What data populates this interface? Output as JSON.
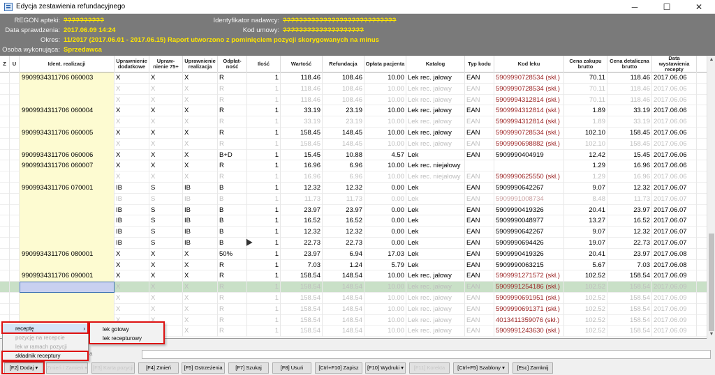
{
  "window": {
    "title": "Edycja zestawienia refundacyjnego",
    "min": "─",
    "max": "☐",
    "close": "✕"
  },
  "header": {
    "regon_label": "REGON apteki:",
    "regon_value": "??????????",
    "data_label": "Data sprawdzenia:",
    "data_value": "2017.06.09 14:24",
    "okres_label": "Okres:",
    "okres_value": "11/2017 (2017.06.01 - 2017.06.15) Raport utworzono z pominięciem pozycji skorygowanych na minus",
    "osoba_label": "Osoba wykonująca:",
    "osoba_value": "Sprzedawca",
    "nadawca_label": "Identyfikator nadawcy:",
    "nadawca_value": "????????????????????????????",
    "umowa_label": "Kod umowy:",
    "umowa_value": "????????????????????"
  },
  "columns": [
    "Z",
    "U",
    "Ident. realizacji",
    "Uprawnienie dodatkowe",
    "Upraw-nienie 75+",
    "Uprawnienie realizacja",
    "Odpłat-ność",
    "Ilość",
    "Wartość",
    "Refundacja",
    "Opłata pacjenta",
    "Katalog",
    "Typ kodu",
    "Kod leku",
    "Cena zakupu brutto",
    "Cena detaliczna brutto",
    "Data wystawienia recepty"
  ],
  "rows": [
    {
      "d": 0,
      "id": "9909934311706  060003",
      "ud": "X",
      "u75": "X",
      "ur": "X",
      "od": "R",
      "il": "1",
      "wa": "118.46",
      "re": "108.46",
      "op": "10.00",
      "ka": "Lek rec. jałowy",
      "ty": "EAN",
      "kod": "5909990728534 (skł.)",
      "red": 1,
      "cz": "70.11",
      "cd": "118.46",
      "dt": "2017.06.06"
    },
    {
      "d": 1,
      "id": "",
      "ud": "X",
      "u75": "X",
      "ur": "X",
      "od": "R",
      "il": "1",
      "wa": "118.46",
      "re": "108.46",
      "op": "10.00",
      "ka": "Lek rec. jałowy",
      "ty": "EAN",
      "kod": "5909990728534 (skł.)",
      "red": 1,
      "cz": "70.11",
      "cd": "118.46",
      "dt": "2017.06.06"
    },
    {
      "d": 1,
      "id": "",
      "ud": "X",
      "u75": "X",
      "ur": "X",
      "od": "R",
      "il": "1",
      "wa": "118.46",
      "re": "108.46",
      "op": "10.00",
      "ka": "Lek rec. jałowy",
      "ty": "EAN",
      "kod": "5909994312814 (skł.)",
      "red": 1,
      "cz": "70.11",
      "cd": "118.46",
      "dt": "2017.06.06"
    },
    {
      "d": 0,
      "id": "9909934311706  060004",
      "ud": "X",
      "u75": "X",
      "ur": "X",
      "od": "R",
      "il": "1",
      "wa": "33.19",
      "re": "23.19",
      "op": "10.00",
      "ka": "Lek rec. jałowy",
      "ty": "EAN",
      "kod": "5909994312814 (skł.)",
      "red": 1,
      "cz": "1.89",
      "cd": "33.19",
      "dt": "2017.06.06"
    },
    {
      "d": 1,
      "id": "",
      "ud": "X",
      "u75": "X",
      "ur": "X",
      "od": "R",
      "il": "1",
      "wa": "33.19",
      "re": "23.19",
      "op": "10.00",
      "ka": "Lek rec. jałowy",
      "ty": "EAN",
      "kod": "5909994312814 (skł.)",
      "red": 1,
      "cz": "1.89",
      "cd": "33.19",
      "dt": "2017.06.06"
    },
    {
      "d": 0,
      "id": "9909934311706  060005",
      "ud": "X",
      "u75": "X",
      "ur": "X",
      "od": "R",
      "il": "1",
      "wa": "158.45",
      "re": "148.45",
      "op": "10.00",
      "ka": "Lek rec. jałowy",
      "ty": "EAN",
      "kod": "5909990728534 (skł.)",
      "red": 1,
      "cz": "102.10",
      "cd": "158.45",
      "dt": "2017.06.06"
    },
    {
      "d": 1,
      "id": "",
      "ud": "X",
      "u75": "X",
      "ur": "X",
      "od": "R",
      "il": "1",
      "wa": "158.45",
      "re": "148.45",
      "op": "10.00",
      "ka": "Lek rec. jałowy",
      "ty": "EAN",
      "kod": "5909990698882 (skł.)",
      "red": 1,
      "cz": "102.10",
      "cd": "158.45",
      "dt": "2017.06.06"
    },
    {
      "d": 0,
      "id": "9909934311706  060006",
      "ud": "X",
      "u75": "X",
      "ur": "X",
      "od": "B+D",
      "il": "1",
      "wa": "15.45",
      "re": "10.88",
      "op": "4.57",
      "ka": "Lek",
      "ty": "EAN",
      "kod": "5909990404919",
      "red": 0,
      "cz": "12.42",
      "cd": "15.45",
      "dt": "2017.06.06"
    },
    {
      "d": 0,
      "id": "9909934311706  060007",
      "ud": "X",
      "u75": "X",
      "ur": "X",
      "od": "R",
      "il": "1",
      "wa": "16.96",
      "re": "6.96",
      "op": "10.00",
      "ka": "Lek rec. niejałowy",
      "ty": "",
      "kod": "",
      "red": 0,
      "cz": "1.29",
      "cd": "16.96",
      "dt": "2017.06.06"
    },
    {
      "d": 1,
      "id": "",
      "ud": "X",
      "u75": "X",
      "ur": "X",
      "od": "R",
      "il": "1",
      "wa": "16.96",
      "re": "6.96",
      "op": "10.00",
      "ka": "Lek rec. niejałowy",
      "ty": "EAN",
      "kod": "5909990625550 (skł.)",
      "red": 1,
      "cz": "1.29",
      "cd": "16.96",
      "dt": "2017.06.06"
    },
    {
      "d": 0,
      "id": "9909934311706  070001",
      "ud": "IB",
      "u75": "S",
      "ur": "IB",
      "od": "B",
      "il": "1",
      "wa": "12.32",
      "re": "12.32",
      "op": "0.00",
      "ka": "Lek",
      "ty": "EAN",
      "kod": "5909990642267",
      "red": 0,
      "cz": "9.07",
      "cd": "12.32",
      "dt": "2017.06.07"
    },
    {
      "d": 1,
      "id": "",
      "ud": "IB",
      "u75": "S",
      "ur": "IB",
      "od": "B",
      "il": "1",
      "wa": "11.73",
      "re": "11.73",
      "op": "0.00",
      "ka": "Lek",
      "ty": "EAN",
      "kod": "5909991008734",
      "red": 0,
      "cz": "8.48",
      "cd": "11.73",
      "dt": "2017.06.07"
    },
    {
      "d": 0,
      "id": "",
      "ud": "IB",
      "u75": "S",
      "ur": "IB",
      "od": "B",
      "il": "1",
      "wa": "23.97",
      "re": "23.97",
      "op": "0.00",
      "ka": "Lek",
      "ty": "EAN",
      "kod": "5909990419326",
      "red": 0,
      "cz": "20.41",
      "cd": "23.97",
      "dt": "2017.06.07"
    },
    {
      "d": 0,
      "id": "",
      "ud": "IB",
      "u75": "S",
      "ur": "IB",
      "od": "B",
      "il": "1",
      "wa": "16.52",
      "re": "16.52",
      "op": "0.00",
      "ka": "Lek",
      "ty": "EAN",
      "kod": "5909990048977",
      "red": 0,
      "cz": "13.27",
      "cd": "16.52",
      "dt": "2017.06.07"
    },
    {
      "d": 0,
      "id": "",
      "ud": "IB",
      "u75": "S",
      "ur": "IB",
      "od": "B",
      "il": "1",
      "wa": "12.32",
      "re": "12.32",
      "op": "0.00",
      "ka": "Lek",
      "ty": "EAN",
      "kod": "5909990642267",
      "red": 0,
      "cz": "9.07",
      "cd": "12.32",
      "dt": "2017.06.07"
    },
    {
      "d": 0,
      "id": "",
      "ud": "IB",
      "u75": "S",
      "ur": "IB",
      "od": "B",
      "il": "1",
      "wa": "22.73",
      "re": "22.73",
      "op": "0.00",
      "ka": "Lek",
      "ty": "EAN",
      "kod": "5909990694426",
      "red": 0,
      "cz": "19.07",
      "cd": "22.73",
      "dt": "2017.06.07"
    },
    {
      "d": 0,
      "id": "9909934311706  080001",
      "ud": "X",
      "u75": "X",
      "ur": "X",
      "od": "50%",
      "il": "1",
      "wa": "23.97",
      "re": "6.94",
      "op": "17.03",
      "ka": "Lek",
      "ty": "EAN",
      "kod": "5909990419326",
      "red": 0,
      "cz": "20.41",
      "cd": "23.97",
      "dt": "2017.06.08"
    },
    {
      "d": 0,
      "id": "",
      "ud": "X",
      "u75": "X",
      "ur": "X",
      "od": "R",
      "il": "1",
      "wa": "7.03",
      "re": "1.24",
      "op": "5.79",
      "ka": "Lek",
      "ty": "EAN",
      "kod": "5909990063215",
      "red": 0,
      "cz": "5.67",
      "cd": "7.03",
      "dt": "2017.06.08"
    },
    {
      "d": 0,
      "id": "9909934311706  090001",
      "ud": "X",
      "u75": "X",
      "ur": "X",
      "od": "R",
      "il": "1",
      "wa": "158.54",
      "re": "148.54",
      "op": "10.00",
      "ka": "Lek rec. jałowy",
      "ty": "EAN",
      "kod": "5909991271572 (skł.)",
      "red": 1,
      "cz": "102.52",
      "cd": "158.54",
      "dt": "2017.06.09"
    },
    {
      "d": 1,
      "sel": 1,
      "id": "",
      "ud": "X",
      "u75": "X",
      "ur": "X",
      "od": "R",
      "il": "1",
      "wa": "158.54",
      "re": "148.54",
      "op": "10.00",
      "ka": "Lek rec. jałowy",
      "ty": "EAN",
      "kod": "5909991254186 (skł.)",
      "red": 1,
      "cz": "102.52",
      "cd": "158.54",
      "dt": "2017.06.09"
    },
    {
      "d": 1,
      "id": "",
      "ud": "X",
      "u75": "X",
      "ur": "X",
      "od": "R",
      "il": "1",
      "wa": "158.54",
      "re": "148.54",
      "op": "10.00",
      "ka": "Lek rec. jałowy",
      "ty": "EAN",
      "kod": "5909990691951 (skł.)",
      "red": 1,
      "cz": "102.52",
      "cd": "158.54",
      "dt": "2017.06.09"
    },
    {
      "d": 1,
      "id": "",
      "ud": "X",
      "u75": "X",
      "ur": "X",
      "od": "R",
      "il": "1",
      "wa": "158.54",
      "re": "148.54",
      "op": "10.00",
      "ka": "Lek rec. jałowy",
      "ty": "EAN",
      "kod": "5909990691371 (skł.)",
      "red": 1,
      "cz": "102.52",
      "cd": "158.54",
      "dt": "2017.06.09"
    },
    {
      "d": 1,
      "id": "",
      "ud": "X",
      "u75": "X",
      "ur": "X",
      "od": "R",
      "il": "1",
      "wa": "158.54",
      "re": "148.54",
      "op": "10.00",
      "ka": "Lek rec. jałowy",
      "ty": "EAN",
      "kod": "4013411359076 (skł.)",
      "red": 1,
      "cz": "102.52",
      "cd": "158.54",
      "dt": "2017.06.09"
    },
    {
      "d": 1,
      "id": "",
      "ud": "X",
      "u75": "X",
      "ur": "X",
      "od": "R",
      "il": "1",
      "wa": "158.54",
      "re": "148.54",
      "op": "10.00",
      "ka": "Lek rec. jałowy",
      "ty": "EAN",
      "kod": "5909991243630 (skł.)",
      "red": 1,
      "cz": "102.52",
      "cd": "158.54",
      "dt": "2017.06.09"
    }
  ],
  "menu": {
    "recepte": "receptę",
    "pozycja": "pozycję na recepcie",
    "lek_w_ramach": "lek w ramach pozycji",
    "skladnik": "składnik receptury",
    "lek_gotowy": "lek gotowy",
    "lek_recepturowy": "lek recepturowy",
    "submenu_arrow": "›"
  },
  "filter": {
    "prefix": "a",
    "value": ""
  },
  "toolbar": {
    "dodaj": "[F2] Dodaj ▾",
    "zamien": "Zmień / Zamień ▾",
    "karta": "[F3] Karta pozycji",
    "zmien": "[F4] Zmień",
    "ostrzezenia": "[F5] Ostrzeżenia",
    "szukaj": "[F7] Szukaj",
    "usun": "[F8] Usuń",
    "zapisz": "[Ctrl+F10] Zapisz",
    "wydruki": "[F10] Wydruki ▾",
    "korekta": "[F11] Korekta",
    "szablony": "[Ctrl+F5] Szablony ▾",
    "zamknij": "[Esc] Zamknij"
  },
  "colors": {
    "header_bg": "#7a7a7a",
    "header_value": "#ffe600",
    "ident_bg": "#fdfbd1",
    "selected_row": "#c9e0c7",
    "highlight": "#dd1111"
  }
}
